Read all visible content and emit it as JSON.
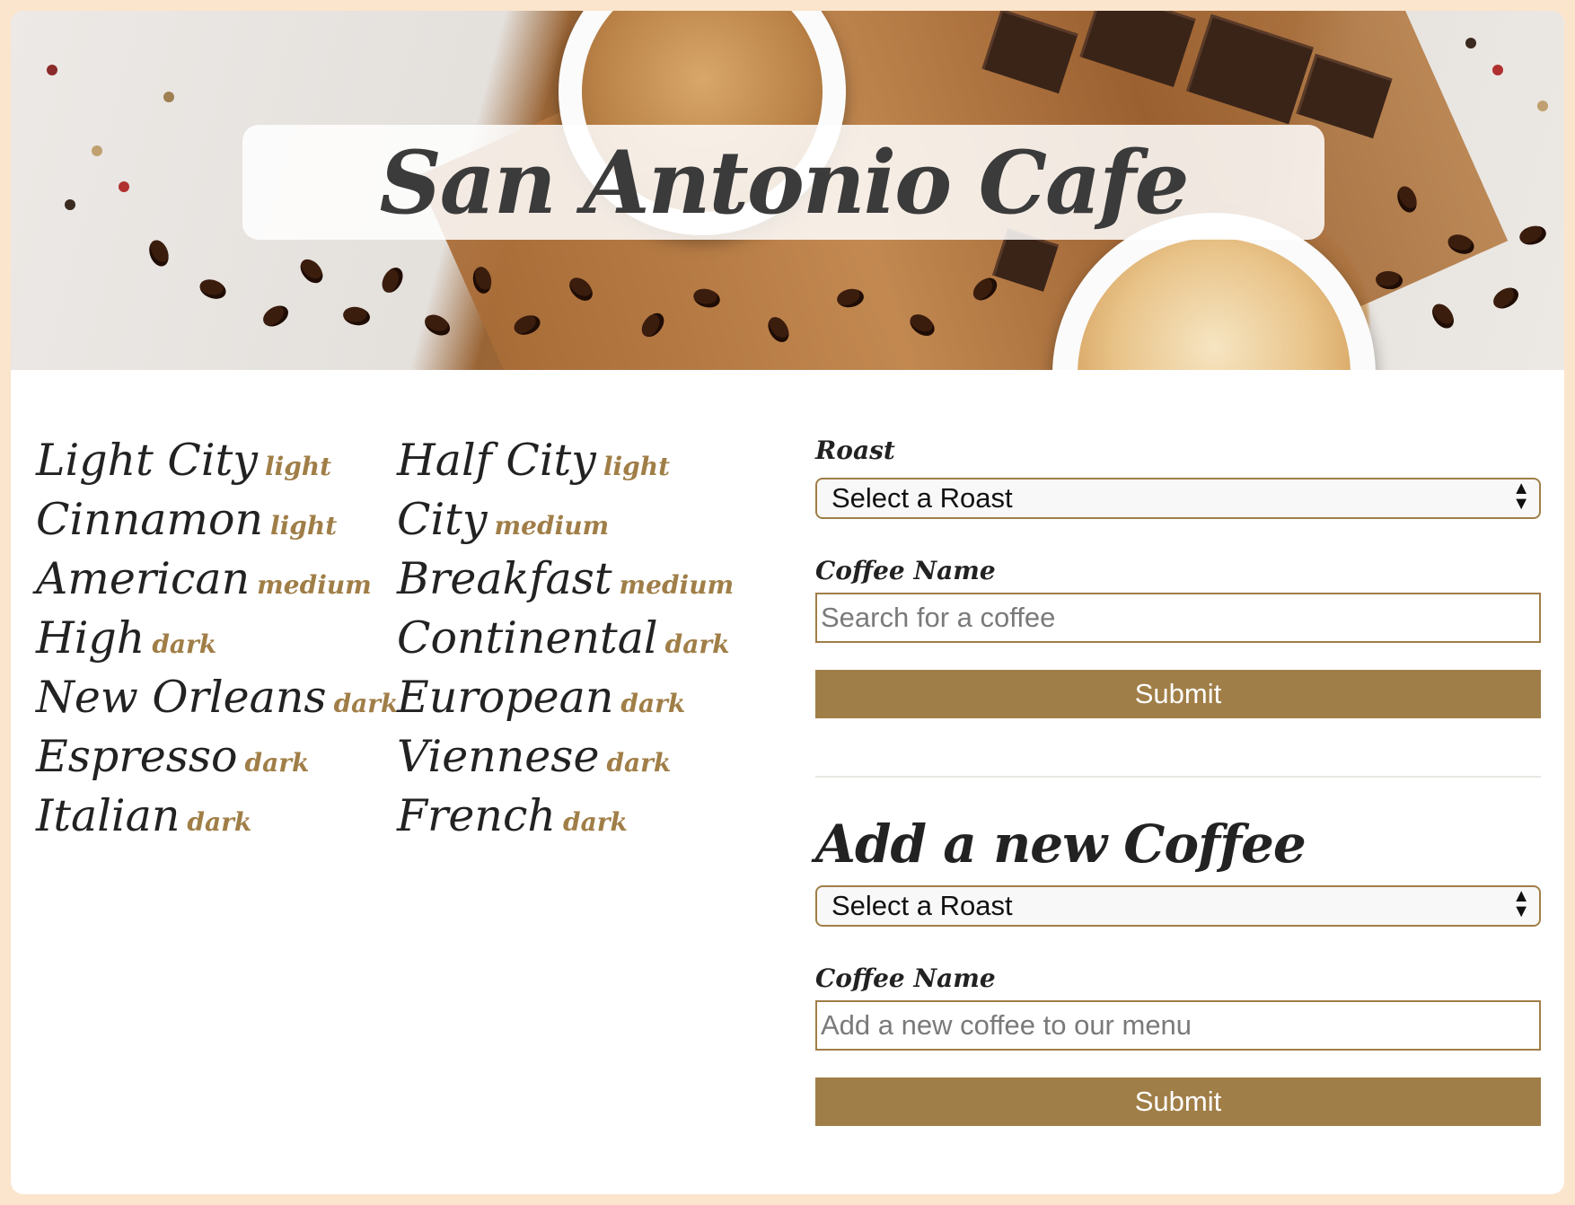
{
  "header": {
    "title": "San Antonio Cafe"
  },
  "coffees": {
    "column1": [
      {
        "name": "Light City",
        "roast": "light"
      },
      {
        "name": "Cinnamon",
        "roast": "light"
      },
      {
        "name": "American",
        "roast": "medium"
      },
      {
        "name": "High",
        "roast": "dark"
      },
      {
        "name": "New Orleans",
        "roast": "dark"
      },
      {
        "name": "Espresso",
        "roast": "dark"
      },
      {
        "name": "Italian",
        "roast": "dark"
      }
    ],
    "column2": [
      {
        "name": "Half City",
        "roast": "light"
      },
      {
        "name": "City",
        "roast": "medium"
      },
      {
        "name": "Breakfast",
        "roast": "medium"
      },
      {
        "name": "Continental",
        "roast": "dark"
      },
      {
        "name": "European",
        "roast": "dark"
      },
      {
        "name": "Viennese",
        "roast": "dark"
      },
      {
        "name": "French",
        "roast": "dark"
      }
    ]
  },
  "search_form": {
    "roast_label": "Roast",
    "roast_select": "Select a Roast",
    "name_label": "Coffee Name",
    "name_placeholder": "Search for a coffee",
    "submit_label": "Submit"
  },
  "add_form": {
    "heading": "Add a new Coffee",
    "roast_select": "Select a Roast",
    "name_label": "Coffee Name",
    "name_placeholder": "Add a new coffee to our menu",
    "submit_label": "Submit"
  },
  "colors": {
    "page_background": "#fbe5cd",
    "accent": "#a07e47",
    "text": "#222222"
  }
}
